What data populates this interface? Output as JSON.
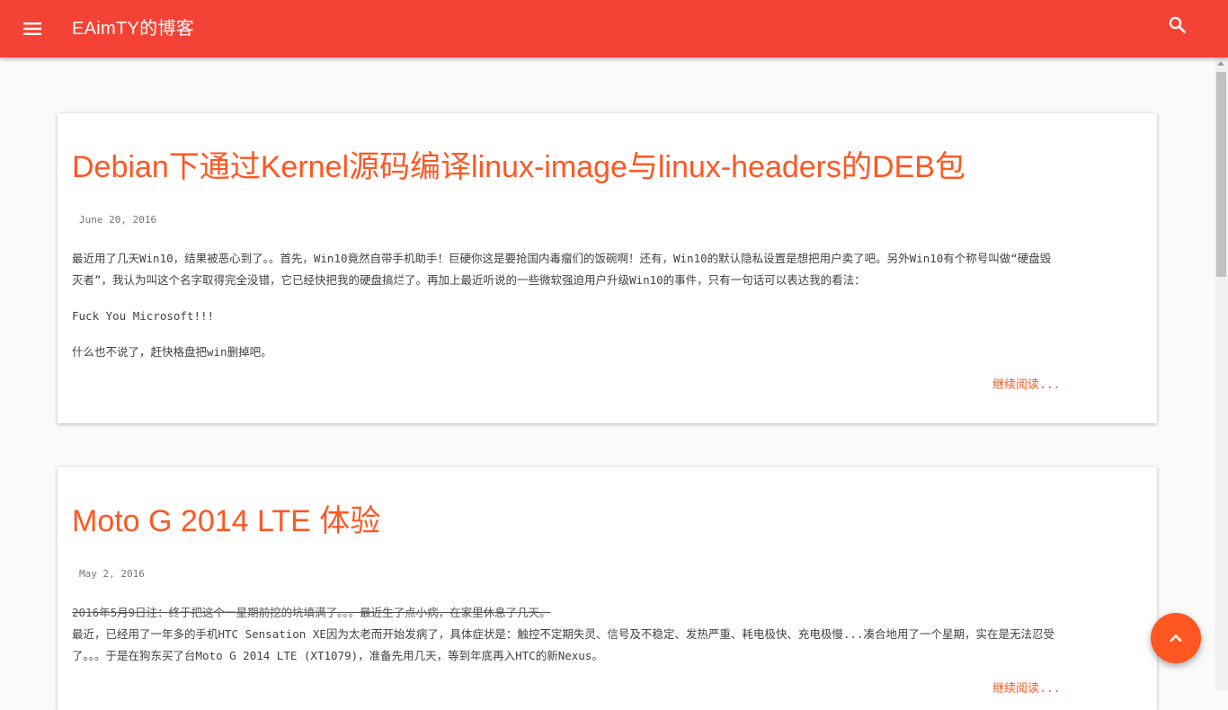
{
  "header": {
    "site_title": "EAimTY的博客",
    "menu_icon": "menu-icon",
    "search_icon": "search-icon",
    "accent_color": "#f44336"
  },
  "posts": [
    {
      "title": "Debian下通过Kernel源码编译linux-image与linux-headers的DEB包",
      "date": "June 20, 2016",
      "paragraphs": [
        "最近用了几天Win10，结果被恶心到了。。首先，Win10竟然自带手机助手！巨硬你这是要抢国内毒瘤们的饭碗啊！还有，Win10的默认隐私设置是想把用户卖了吧。另外Win10有个称号叫做“硬盘毁灭者”，我认为叫这个名字取得完全没错，它已经快把我的硬盘搞烂了。再加上最近听说的一些微软强迫用户升级Win10的事件，只有一句话可以表达我的看法：",
        "Fuck You Microsoft!!!",
        "什么也不说了，赶快格盘把win删掉吧。"
      ],
      "read_more": "继续阅读..."
    },
    {
      "title": "Moto G 2014 LTE 体验",
      "date": "May 2, 2016",
      "struck_note": "2016年5月9日注：终于把这个一星期前挖的坑填满了。。。最近生了点小病，在家里休息了几天。",
      "paragraph": "最近，已经用了一年多的手机HTC Sensation XE因为太老而开始发病了，具体症状是：触控不定期失灵、信号及不稳定、发热严重、耗电极快、充电极慢...凑合地用了一个星期，实在是无法忍受了。。。于是在狗东买了台Moto G 2014 LTE (XT1079)，准备先用几天，等到年底再入HTC的新Nexus。",
      "read_more": "继续阅读..."
    }
  ],
  "fab": {
    "icon": "chevron-up-icon",
    "color": "#ff5722"
  }
}
